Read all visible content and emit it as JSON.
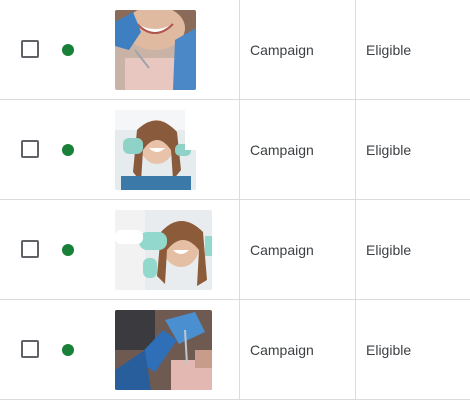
{
  "rows": [
    {
      "campaign": "Campaign",
      "status": "Eligible",
      "status_color": "#188038",
      "checked": false,
      "image": "dental-patient-smiling-closeup"
    },
    {
      "campaign": "Campaign",
      "status": "Eligible",
      "status_color": "#188038",
      "checked": false,
      "image": "woman-in-dental-chair-smiling"
    },
    {
      "campaign": "Campaign",
      "status": "Eligible",
      "status_color": "#188038",
      "checked": false,
      "image": "woman-smiling-dentist-gloves"
    },
    {
      "campaign": "Campaign",
      "status": "Eligible",
      "status_color": "#188038",
      "checked": false,
      "image": "dentist-hands-blue-gloves"
    }
  ]
}
